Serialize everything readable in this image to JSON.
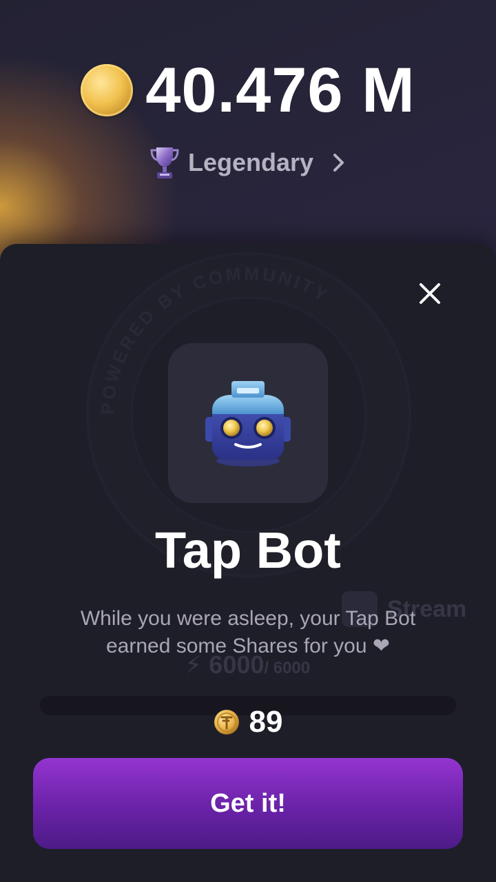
{
  "header": {
    "balance": "40.476 M",
    "rank_label": "Legendary",
    "coin_icon": "gold-coin-icon",
    "trophy_icon": "trophy-icon",
    "chevron_icon": "chevron-right-icon"
  },
  "modal": {
    "title": "Tap Bot",
    "description": "While you were asleep, your Tap Bot earned some Shares for you ❤",
    "reward_amount": "89",
    "button_label": "Get it!",
    "close_icon": "close-icon",
    "bot_icon": "robot-icon"
  },
  "background": {
    "watermark_text": "POWERED BY COMMUNITY",
    "stream_label": "Stream",
    "energy_value": "6000",
    "energy_max": "/ 6000"
  },
  "colors": {
    "accent_purple": "#8a2fc8",
    "sheet_bg": "#1e1e29",
    "gold": "#f1c250"
  }
}
